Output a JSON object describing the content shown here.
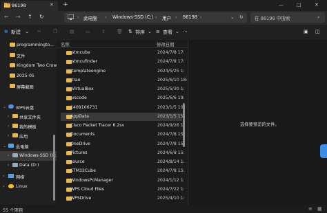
{
  "window": {
    "tab_title": "86198",
    "close_tab": "✕",
    "new_tab": "+",
    "minimize": "—",
    "maximize": "□",
    "close": "✕"
  },
  "address": {
    "crumbs": [
      "此电脑",
      "Windows-SSD (C:)",
      "用户",
      "86198"
    ],
    "search_placeholder": "在 86198 中搜索"
  },
  "toolbar": {
    "new_label": "新建",
    "sort_label": "排序",
    "view_label": "查看",
    "more_label": "···"
  },
  "nav": [
    {
      "label": "programmingto..."
    },
    {
      "label": "文件"
    },
    {
      "label": "Kingdom Two Crow"
    },
    {
      "label": "2025-05"
    },
    {
      "label": "屏幕截图"
    },
    {
      "label": "WPS云盘"
    },
    {
      "label": "共享文件夹"
    },
    {
      "label": "我的模板"
    },
    {
      "label": "应用"
    },
    {
      "label": "此电脑"
    },
    {
      "label": "Windows-SSD (C:)"
    },
    {
      "label": "Data (D:)"
    },
    {
      "label": "网络"
    },
    {
      "label": "Linux"
    }
  ],
  "columns": {
    "name": "名称",
    "date": "修改日期"
  },
  "files": [
    {
      "name": ".stmcube",
      "date": "2024/7/8 17:"
    },
    {
      "name": ".stmcufinder",
      "date": "2024/7/8 17:"
    },
    {
      "name": ".templateengine",
      "date": "2024/5/25 1:"
    },
    {
      "name": ".trae",
      "date": "2025/6/10 18:"
    },
    {
      "name": ".VirtualBox",
      "date": "2025/5/30 1:"
    },
    {
      "name": ".vscode",
      "date": "2025/6/6 19:"
    },
    {
      "name": "1409106731",
      "date": "2023/1/5 10:"
    },
    {
      "name": "AppData",
      "date": "2023/1/5 15:"
    },
    {
      "name": "Cisco Packet Tracer 6.2sv",
      "date": "2024/9/26 1:"
    },
    {
      "name": "Documents",
      "date": "2024/7/8 15:"
    },
    {
      "name": "OneDrive",
      "date": "2024/7/8 15:"
    },
    {
      "name": "Pictures",
      "date": "2024/6/8 15:"
    },
    {
      "name": "source",
      "date": "2024/8/14 1:"
    },
    {
      "name": "STM32Cube",
      "date": "2024/7/8 15:"
    },
    {
      "name": "WindowsPcManager",
      "date": "2024/1/12 1:"
    },
    {
      "name": "WPS Cloud Files",
      "date": "2024/7/22 1:"
    },
    {
      "name": "WPSDrive",
      "date": "2025/4/10 1:"
    }
  ],
  "preview": {
    "message": "选择要预览的文件。"
  },
  "status": {
    "count": "55 个项目"
  }
}
